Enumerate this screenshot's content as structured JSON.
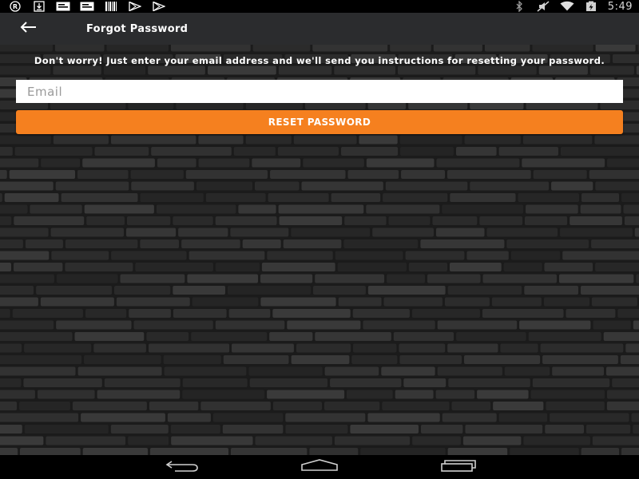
{
  "status_bar": {
    "left_icons": [
      "registered-icon",
      "download-icon",
      "message-icon",
      "message-icon",
      "barcode-icon",
      "play-store-icon",
      "play-store-icon"
    ],
    "right_icons": [
      "bluetooth-icon",
      "mute-icon",
      "wifi-icon",
      "battery-charging-icon"
    ],
    "time": "5:49"
  },
  "app_bar": {
    "back_icon": "arrow-left-icon",
    "title": "Forgot Password"
  },
  "form": {
    "instructions": "Don't worry! Just enter your email address and we'll send you instructions for resetting your password.",
    "email_placeholder": "Email",
    "email_value": "",
    "reset_label": "RESET PASSWORD"
  },
  "colors": {
    "accent": "#f5801f",
    "app_bar": "#2b2c2e",
    "background": "#2f2f2f"
  },
  "nav_bar": {
    "icons": [
      "back-nav-icon",
      "home-nav-icon",
      "recents-nav-icon"
    ]
  }
}
